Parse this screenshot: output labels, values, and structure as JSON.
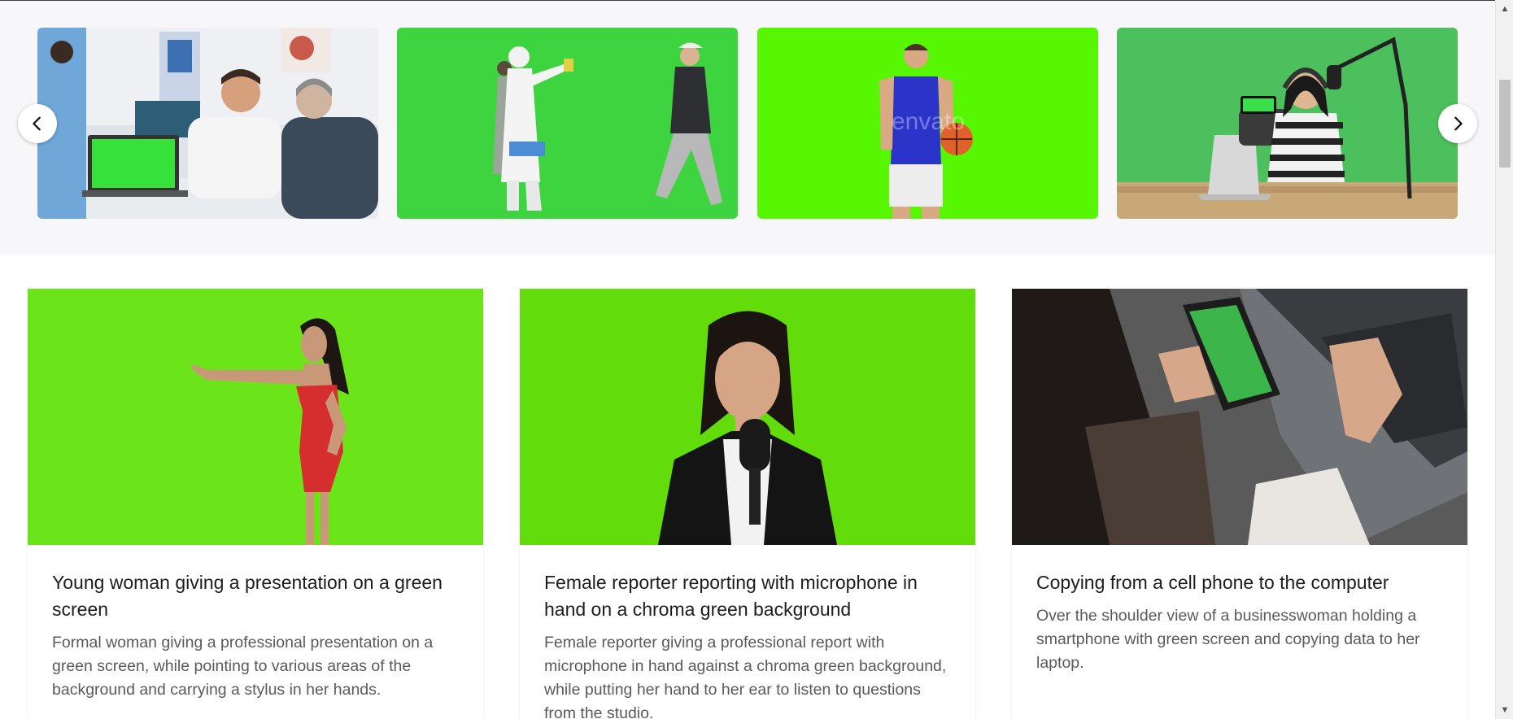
{
  "carousel": {
    "prev_icon": "chevron-left-icon",
    "next_icon": "chevron-right-icon",
    "slides": [
      {
        "scene": "doctor-laptop-green-screen"
      },
      {
        "scene": "people-walking-green-screen"
      },
      {
        "scene": "basketball-player-green-screen",
        "watermark": "envato"
      },
      {
        "scene": "podcaster-phone-green-screen"
      }
    ]
  },
  "cards": [
    {
      "title": "Young woman giving a presentation on a green screen",
      "description": "Formal woman giving a professional presentation on a green screen, while pointing to various areas of the background and carrying a stylus in her hands."
    },
    {
      "title": "Female reporter reporting with microphone in hand on a chroma green background",
      "description": "Female reporter giving a professional report with microphone in hand against a chroma green background, while putting her hand to her ear to listen to questions from the studio."
    },
    {
      "title": "Copying from a cell phone to the computer",
      "description": "Over the shoulder view of a businesswoman holding a smartphone with green screen and copying data to her laptop."
    }
  ],
  "colors": {
    "chroma_green_1": "#3ed440",
    "chroma_green_2": "#56f700",
    "chroma_green_3": "#4cc05c",
    "chroma_green_4": "#6be41a",
    "card_title": "#1d1d1f",
    "card_text": "#5a5a5a"
  }
}
